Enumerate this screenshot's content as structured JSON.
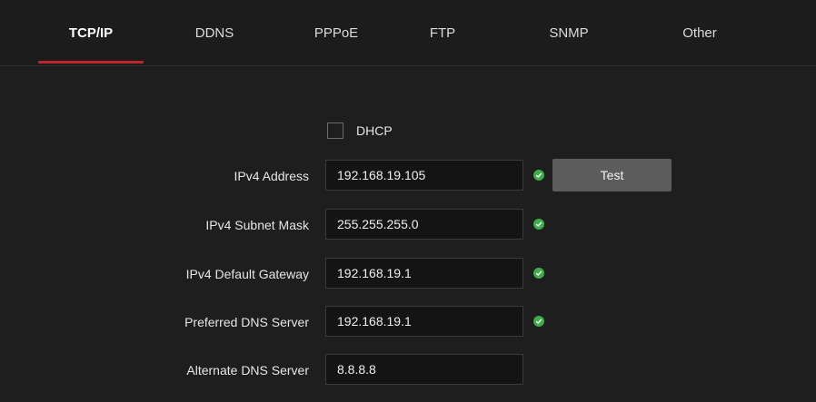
{
  "tabs": [
    {
      "label": "TCP/IP"
    },
    {
      "label": "DDNS"
    },
    {
      "label": "PPPoE"
    },
    {
      "label": "FTP"
    },
    {
      "label": "SNMP"
    },
    {
      "label": "Other"
    }
  ],
  "active_tab": "TCP/IP",
  "dhcp": {
    "label": "DHCP",
    "checked": false
  },
  "fields": {
    "ipv4_address": {
      "label": "IPv4 Address",
      "value": "192.168.19.105",
      "valid": true
    },
    "subnet_mask": {
      "label": "IPv4 Subnet Mask",
      "value": "255.255.255.0",
      "valid": true
    },
    "default_gateway": {
      "label": "IPv4 Default Gateway",
      "value": "192.168.19.1",
      "valid": true
    },
    "preferred_dns": {
      "label": "Preferred DNS Server",
      "value": "192.168.19.1",
      "valid": true
    },
    "alternate_dns": {
      "label": "Alternate DNS Server",
      "value": "8.8.8.8"
    }
  },
  "test_button": {
    "label": "Test"
  },
  "colors": {
    "accent": "#c0242b",
    "valid": "#3fae49",
    "background": "#1e1e1e"
  },
  "icons": {
    "valid_indicator": "check-circle-icon"
  }
}
